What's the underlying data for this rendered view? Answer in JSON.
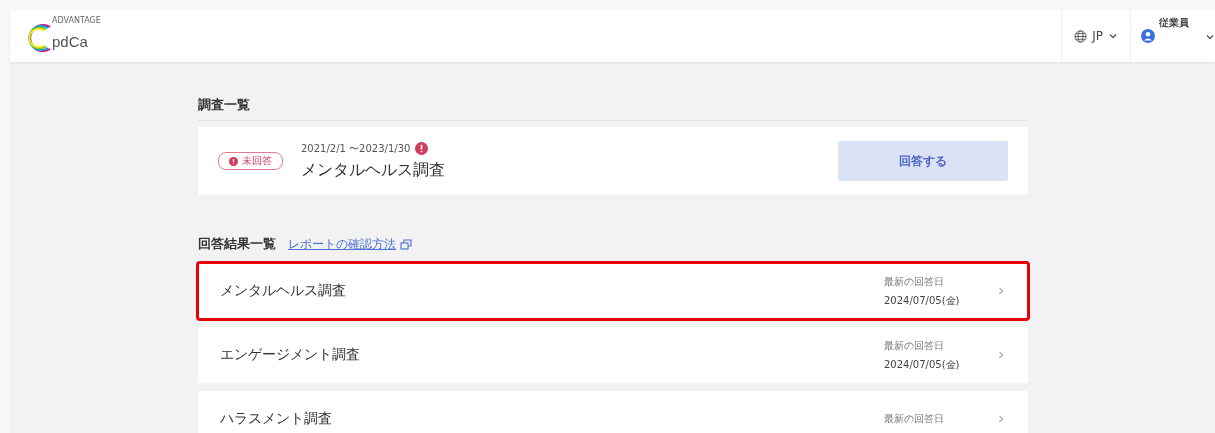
{
  "header": {
    "logo": {
      "tagline": "ADVANTAGE",
      "wordmark": "pdCa"
    },
    "language": "JP",
    "user_role": "従業員"
  },
  "surveys": {
    "heading": "調査一覧",
    "items": [
      {
        "status": "未回答",
        "period": "2021/2/1 〜2023/1/30",
        "alert": true,
        "title": "メンタルヘルス調査",
        "action": "回答する"
      }
    ]
  },
  "results": {
    "heading": "回答結果一覧",
    "help_link": "レポートの確認方法",
    "rows": [
      {
        "title": "メンタルヘルス調査",
        "date_label": "最新の回答日",
        "date": "2024/07/05(金)",
        "highlighted": true
      },
      {
        "title": "エンゲージメント調査",
        "date_label": "最新の回答日",
        "date": "2024/07/05(金)",
        "highlighted": false
      },
      {
        "title": "ハラスメント調査",
        "date_label": "最新の回答日",
        "highlighted": false
      }
    ]
  }
}
